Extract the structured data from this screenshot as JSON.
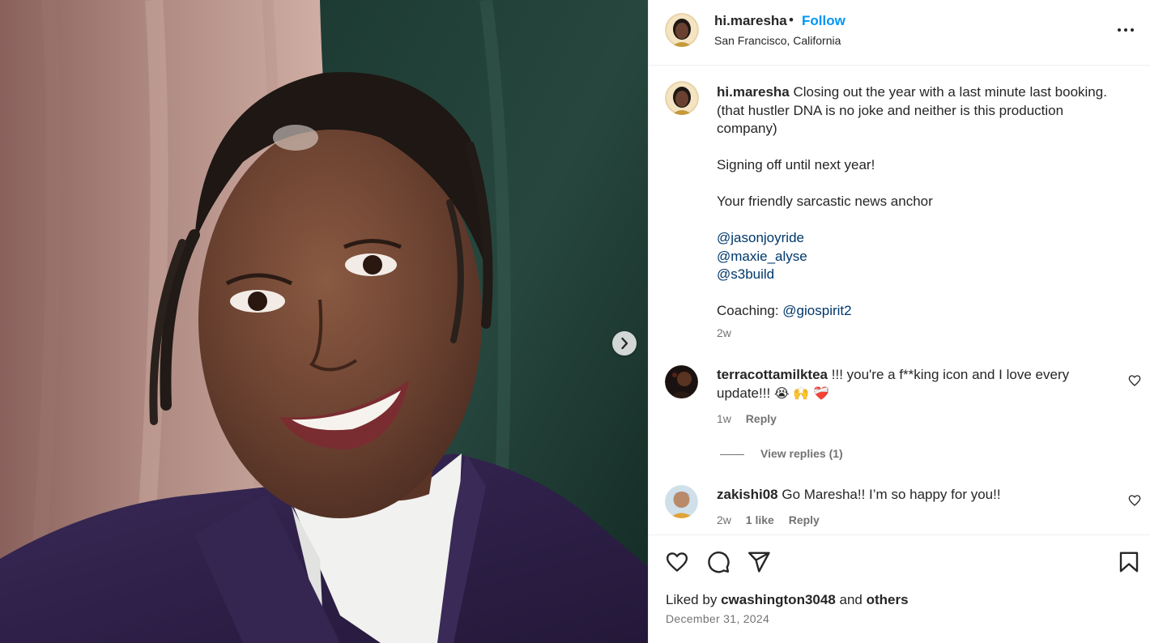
{
  "post": {
    "username": "hi.maresha",
    "separator": "•",
    "follow_label": "Follow",
    "location": "San Francisco, California"
  },
  "caption": {
    "username": "hi.maresha",
    "lines": [
      "Closing out the year with a last minute last booking.",
      "(that hustler DNA is no joke and neither is this production",
      "company)",
      "",
      "Signing off until next year!",
      "",
      "Your friendly sarcastic news anchor",
      ""
    ],
    "mentions": [
      "@jasonjoyride",
      "@maxie_alyse",
      "@s3build"
    ],
    "coaching_label": "Coaching:",
    "coaching_mention": "@giospirit2",
    "time": "2w"
  },
  "comments": [
    {
      "username": "terracottamilktea",
      "text_line1": "!!! you're a f**king icon and I love every",
      "text_line2": "update!!!",
      "emojis": [
        "😭",
        "🙌",
        "❤️‍🩹"
      ],
      "time": "1w",
      "reply_label": "Reply",
      "view_replies": "View replies (1)"
    },
    {
      "username": "zakishi08",
      "text": "Go Maresha!! I’m so happy for you!!",
      "time": "2w",
      "likes": "1 like",
      "reply_label": "Reply"
    }
  ],
  "likes": {
    "prefix": "Liked by",
    "user": "cwashington3048",
    "and": "and",
    "others": "others"
  },
  "date": "December 31, 2024",
  "icons": {
    "more": "more-horizontal-icon",
    "next": "chevron-right-icon",
    "like": "heart-icon",
    "comment": "comment-bubble-icon",
    "share": "paper-plane-icon",
    "save": "bookmark-icon"
  },
  "colors": {
    "follow": "#0095f6",
    "mention": "#00376b",
    "muted": "#737373",
    "text": "#262626"
  }
}
